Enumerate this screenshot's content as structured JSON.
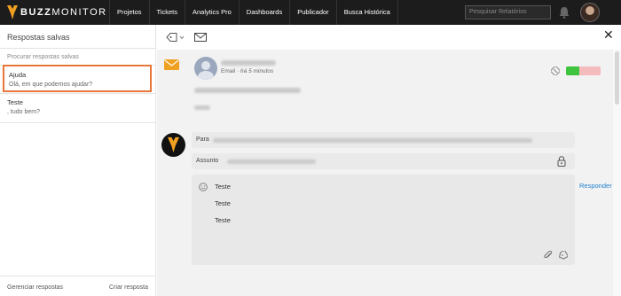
{
  "brand": {
    "name_bold": "BUZZ",
    "name_light": "MONITOR"
  },
  "nav": {
    "items": [
      "Projetos",
      "Tickets",
      "Analytics Pro",
      "Dashboards",
      "Publicador",
      "Busca Histórica"
    ]
  },
  "search": {
    "placeholder": "Pesquisar Relatórios"
  },
  "left_panel": {
    "title": "Respostas salvas",
    "search_placeholder": "Procurar respostas salvas",
    "items": [
      {
        "title": "Ajuda",
        "text": "Olá, em que podemos ajudar?",
        "selected": true
      },
      {
        "title": "Teste",
        "text": ", tudo bem?",
        "selected": false
      }
    ],
    "footer": {
      "manage_label": "Gerenciar respostas",
      "create_label": "Criar resposta"
    }
  },
  "toolbar": {
    "icons": [
      "tag-icon",
      "mail-icon",
      "close-icon"
    ],
    "close_glyph": "✕"
  },
  "message": {
    "channel": "Email",
    "time": "há 5 minutos",
    "status_colors": {
      "green": "#3ec43e",
      "red": "#f4bcbc"
    }
  },
  "reply": {
    "to_label": "Para",
    "subject_label": "Assunto",
    "body_lines": [
      "Teste",
      "Teste",
      "Teste"
    ],
    "reply_label": "Responder"
  },
  "colors": {
    "accent": "#e8763a",
    "link": "#1f7fcf",
    "topbar": "#1c1c1c"
  }
}
